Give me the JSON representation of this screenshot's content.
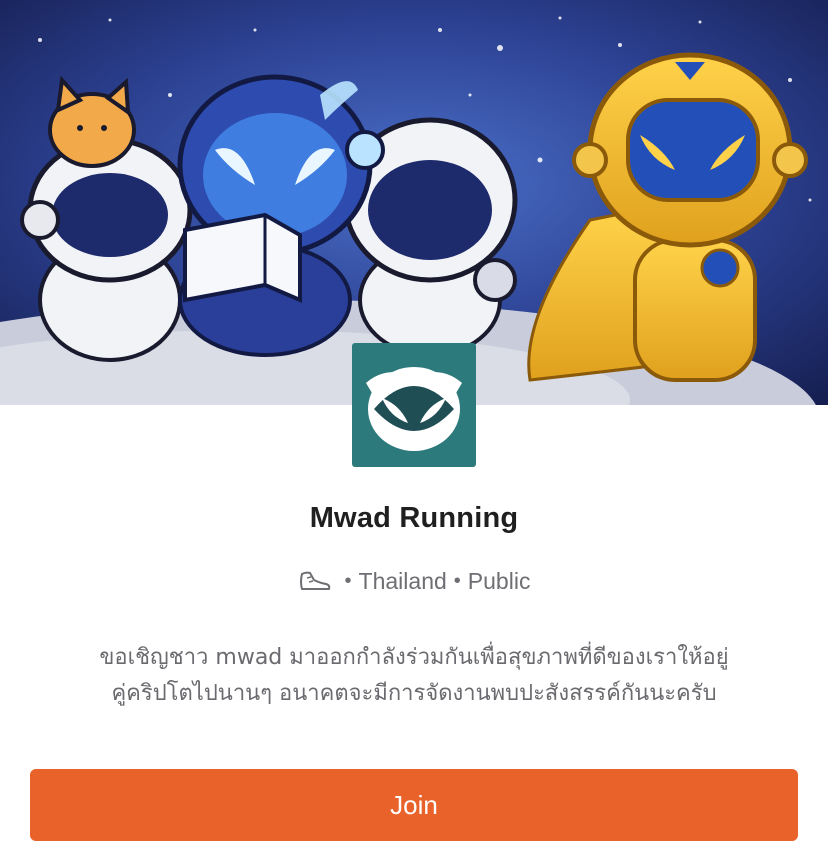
{
  "banner": {
    "description_icon": "space-mascots-banner"
  },
  "club": {
    "name": "Mwad Running",
    "logo_icon": "mwad-mascot-logo",
    "sport_icon": "running-shoe-icon",
    "location": "Thailand",
    "visibility": "Public",
    "separator": "•",
    "description_line1": "ขอเชิญชาว mwad มาออกกำลังร่วมกันเพื่อสุขภาพที่ดีของเราให้อยู่",
    "description_line2": "คู่คริปโตไปนานๆ อนาคตจะมีการจัดงานพบปะสังสรรค์กันนะครับ"
  },
  "actions": {
    "join_label": "Join"
  },
  "colors": {
    "accent": "#e8622a",
    "logo_bg": "#2c7a7b",
    "text_primary": "#1f1f1f",
    "text_secondary": "#6e6e73"
  }
}
